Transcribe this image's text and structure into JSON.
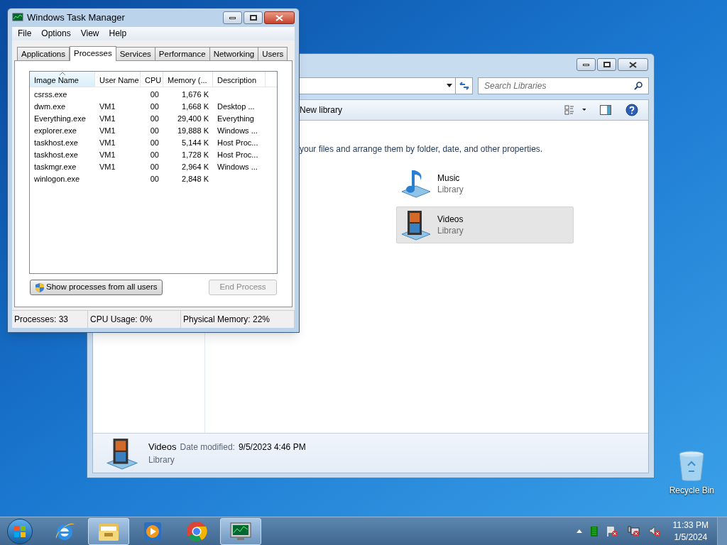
{
  "task_manager": {
    "title": "Windows Task Manager",
    "menu": [
      "File",
      "Options",
      "View",
      "Help"
    ],
    "tabs": [
      {
        "label": "Applications",
        "selected": false
      },
      {
        "label": "Processes",
        "selected": true
      },
      {
        "label": "Services",
        "selected": false
      },
      {
        "label": "Performance",
        "selected": false
      },
      {
        "label": "Networking",
        "selected": false
      },
      {
        "label": "Users",
        "selected": false
      }
    ],
    "columns": [
      {
        "label": "Image Name",
        "sorted": true
      },
      {
        "label": "User Name",
        "sorted": false
      },
      {
        "label": "CPU",
        "sorted": false
      },
      {
        "label": "Memory (...",
        "sorted": false
      },
      {
        "label": "Description",
        "sorted": false
      }
    ],
    "rows": [
      [
        "csrss.exe",
        "",
        "00",
        "1,676 K",
        ""
      ],
      [
        "dwm.exe",
        "VM1",
        "00",
        "1,668 K",
        "Desktop ..."
      ],
      [
        "Everything.exe",
        "VM1",
        "00",
        "29,400 K",
        "Everything"
      ],
      [
        "explorer.exe",
        "VM1",
        "00",
        "19,888 K",
        "Windows ..."
      ],
      [
        "taskhost.exe",
        "VM1",
        "00",
        "5,144 K",
        "Host Proc..."
      ],
      [
        "taskhost.exe",
        "VM1",
        "00",
        "1,728 K",
        "Host Proc..."
      ],
      [
        "taskmgr.exe",
        "VM1",
        "00",
        "2,964 K",
        "Windows ..."
      ],
      [
        "winlogon.exe",
        "",
        "00",
        "2,848 K",
        ""
      ]
    ],
    "buttons": [
      {
        "label": "Show processes from all users",
        "disabled": false
      },
      {
        "label": "End Process",
        "disabled": true
      }
    ],
    "status_bar": [
      "Processes: 33",
      "CPU Usage: 0%",
      "Physical Memory: 22%"
    ]
  },
  "explorer": {
    "search": {
      "placeholder": "Search Libraries"
    },
    "toolbar_item": "New library",
    "description": "your files and arrange them by folder, date, and other properties.",
    "libraries": [
      {
        "name": "Music",
        "type": "Library",
        "kind": "music",
        "selected": false
      },
      {
        "name": "Videos",
        "type": "Library",
        "kind": "videos",
        "selected": true
      }
    ],
    "details": {
      "name": "Videos",
      "date_label": "Date modified:",
      "date": "9/5/2023 4:46 PM",
      "type": "Library"
    }
  },
  "desktop_icons": [
    {
      "label": "Recycle Bin"
    }
  ],
  "taskbar": {
    "apps": [
      {
        "kind": "ie",
        "active": false
      },
      {
        "kind": "explorer",
        "active": true
      },
      {
        "kind": "media",
        "active": false
      },
      {
        "kind": "chrome",
        "active": false
      },
      {
        "kind": "taskmgr",
        "active": true
      }
    ],
    "clock_time": "11:33 PM",
    "clock_date": "1/5/2024"
  }
}
